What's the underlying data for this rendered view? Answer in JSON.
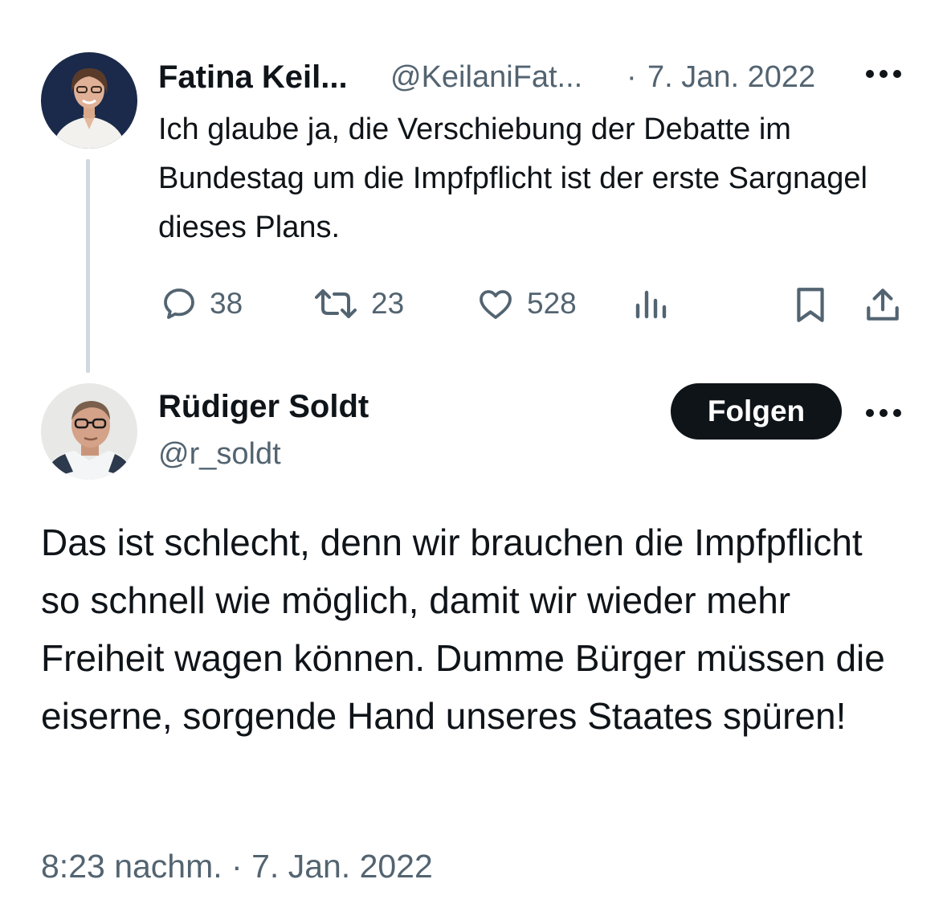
{
  "quoted_tweet": {
    "author_name": "Fatina Keil...",
    "author_handle": "@KeilaniFat...",
    "separator": "·",
    "date": "7. Jan. 2022",
    "text": "Ich glaube ja, die Verschiebung der Debatte im Bundestag um die Impfpflicht ist der erste Sargnagel dieses Plans.",
    "actions": {
      "replies": "38",
      "retweets": "23",
      "likes": "528"
    }
  },
  "main_tweet": {
    "author_name": "Rüdiger Soldt",
    "author_handle": "@r_soldt",
    "follow_label": "Folgen",
    "text": "Das ist schlecht, denn wir brauchen die Impfpflicht so schnell wie möglich, damit wir wieder mehr Freiheit wagen können. Dumme Bürger müssen die eiserne, sorgende Hand unseres Staates spüren!",
    "time": "8:23 nachm.",
    "separator": "·",
    "date": "7. Jan. 2022"
  },
  "icons": {
    "reply": "reply-icon",
    "retweet": "retweet-icon",
    "like": "heart-icon",
    "views": "views-icon",
    "bookmark": "bookmark-icon",
    "share": "share-icon",
    "more": "more-icon"
  },
  "colors": {
    "text": "#0f1419",
    "muted": "#536471",
    "thread_line": "#cfd9de",
    "follow_button": "#0f1419"
  }
}
